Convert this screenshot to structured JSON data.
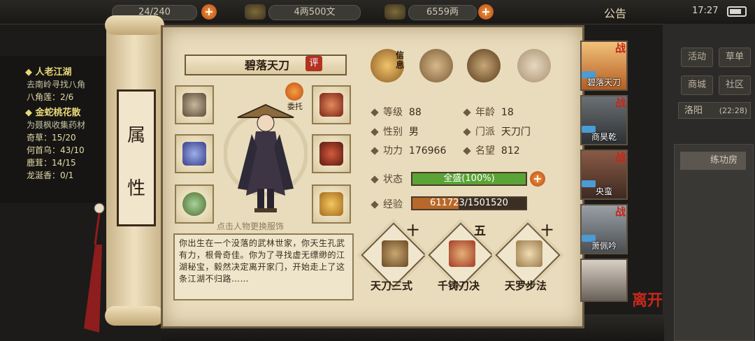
{
  "topbar": {
    "capacity": "24/240",
    "copper": "4两500文",
    "silver": "6559两",
    "notice_label": "公告",
    "clock": "17:27"
  },
  "quest": {
    "items": [
      {
        "text": "◆ 人老江湖",
        "style": "h"
      },
      {
        "text": "去南岭寻找八角",
        "style": "dim"
      },
      {
        "text": "八角莲：2/6",
        "style": "n"
      },
      {
        "text": "◆ 金蛇桃花散",
        "style": "h"
      },
      {
        "text": "为聂枫收集药材",
        "style": "dim"
      },
      {
        "text": "奇草：15/20",
        "style": "n"
      },
      {
        "text": "何首乌：43/10",
        "style": "n"
      },
      {
        "text": "鹿茸：14/15",
        "style": "n"
      },
      {
        "text": "龙涎香：0/1",
        "style": "n"
      }
    ]
  },
  "right_menu": {
    "activity": "活动",
    "herbs": "草单",
    "shop": "商城",
    "community": "社区",
    "location": "洛阳",
    "location_time": "(22:28)",
    "practice_room": "练功房"
  },
  "scroll": {
    "label_chars": [
      "属",
      "性"
    ]
  },
  "character": {
    "name": "碧落天刀",
    "rate_badge": "评",
    "commission_label": "委托",
    "hint": "点击人物更换服饰",
    "bio": "你出生在一个没落的武林世家，你天生孔武有力，根骨奇佳。你为了寻找虚无缥缈的江湖秘宝，毅然决定离开家门，开始走上了这条江湖不归路……"
  },
  "tabs": {
    "info_label": "信息",
    "icons": [
      "info-icon",
      "bag-icon",
      "bagua-icon",
      "meridian-icon"
    ]
  },
  "stats": {
    "level_label": "等级",
    "level": "88",
    "age_label": "年龄",
    "age": "18",
    "gender_label": "性别",
    "gender": "男",
    "sect_label": "门派",
    "sect": "天刀门",
    "power_label": "功力",
    "power": "176966",
    "fame_label": "名望",
    "fame": "812",
    "status_label": "状态",
    "status_text": "全盛(100%)",
    "status_fraction": 1.0,
    "exp_label": "经验",
    "exp_text": "611723/1501520",
    "exp_fraction": 0.407
  },
  "skills": [
    {
      "name": "天刀三式",
      "rank": "十"
    },
    {
      "name": "千铸刀决",
      "rank": "五"
    },
    {
      "name": "天罗步法",
      "rank": "十"
    }
  ],
  "party": [
    {
      "name": "碧落天刀",
      "badge": "战",
      "active": true
    },
    {
      "name": "商昊乾",
      "badge": "战",
      "active": false
    },
    {
      "name": "央蛮",
      "badge": "战",
      "active": false
    },
    {
      "name": "萧佩吟",
      "badge": "战",
      "active": false
    },
    {
      "name": "",
      "badge": "",
      "active": false
    }
  ],
  "leave_label": "离开",
  "colors": {
    "status_bar": "#5aa436",
    "exp_bar": "#b8682a",
    "accent_red": "#c6261a"
  }
}
